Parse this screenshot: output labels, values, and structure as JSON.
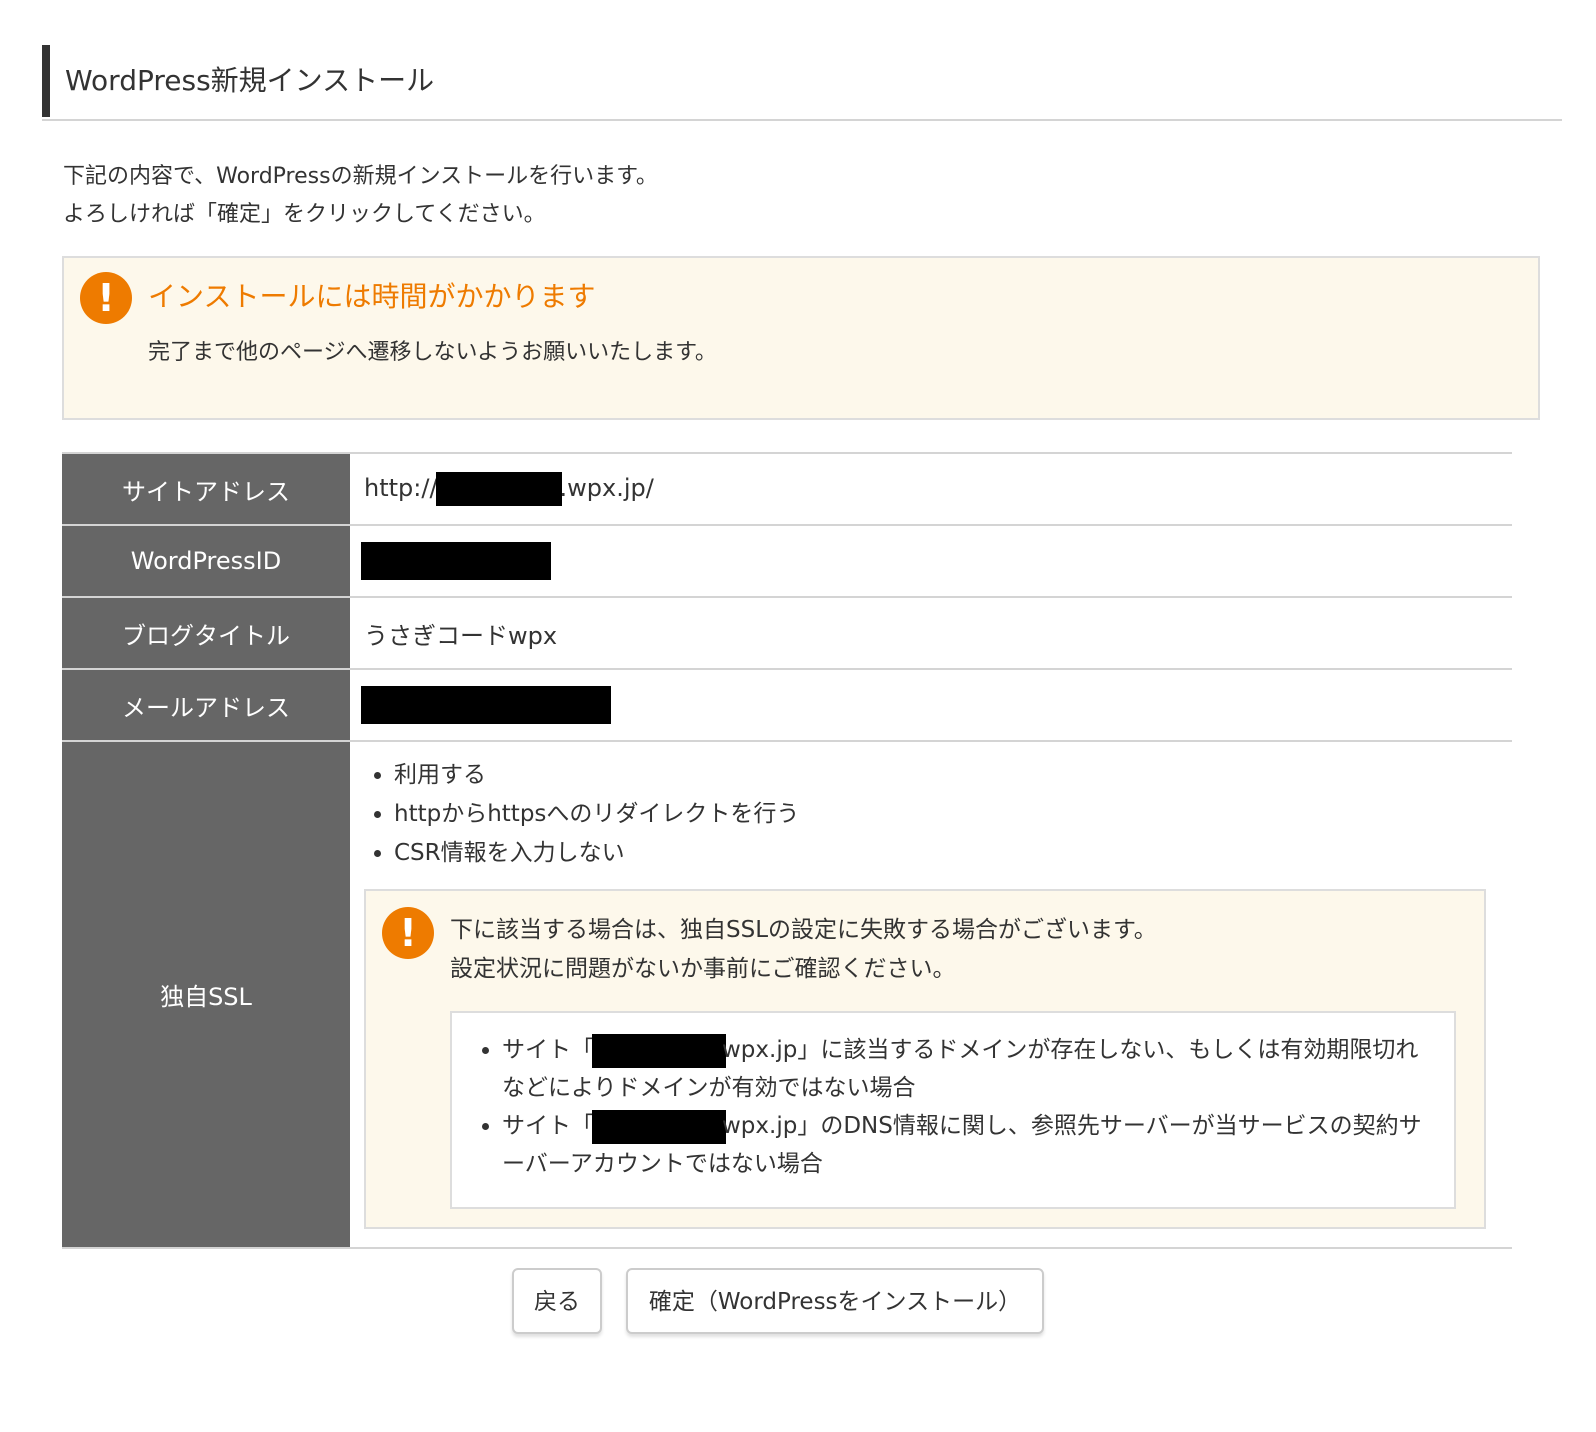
{
  "page": {
    "title": "WordPress新規インストール"
  },
  "intro": {
    "line1": "下記の内容で、WordPressの新規インストールを行います。",
    "line2": "よろしければ「確定」をクリックしてください。"
  },
  "notice": {
    "icon": "exclamation-icon",
    "title": "インストールには時間がかかります",
    "text": "完了まで他のページへ遷移しないようお願いいたします。"
  },
  "table": {
    "site_address": {
      "label": "サイトアドレス",
      "prefix": "http://",
      "suffix": ".wpx.jp/"
    },
    "wordpress_id": {
      "label": "WordPressID"
    },
    "blog_title": {
      "label": "ブログタイトル",
      "value": "うさぎコードwpx"
    },
    "mail_address": {
      "label": "メールアドレス"
    },
    "ssl": {
      "label": "独自SSL",
      "options": [
        "利用する",
        "httpからhttpsへのリダイレクトを行う",
        "CSR情報を入力しない"
      ],
      "warning": {
        "line1": "下に該当する場合は、独自SSLの設定に失敗する場合がございます。",
        "line2": "設定状況に問題がないか事前にご確認ください。",
        "conditions": [
          {
            "prefix": "サイト「",
            "suffix": "wpx.jp」に該当するドメインが存在しない、もしくは有効期限切れなどによりドメインが有効ではない場合"
          },
          {
            "prefix": "サイト「",
            "suffix": "wpx.jp」のDNS情報に関し、参照先サーバーが当サービスの契約サーバーアカウントではない場合"
          }
        ]
      }
    }
  },
  "buttons": {
    "back": "戻る",
    "confirm": "確定（WordPressをインストール）"
  },
  "colors": {
    "accent_orange": "#ee7b00",
    "notice_bg": "#fdf8eb",
    "table_header_bg": "#666666",
    "heading_bar": "#333333"
  }
}
